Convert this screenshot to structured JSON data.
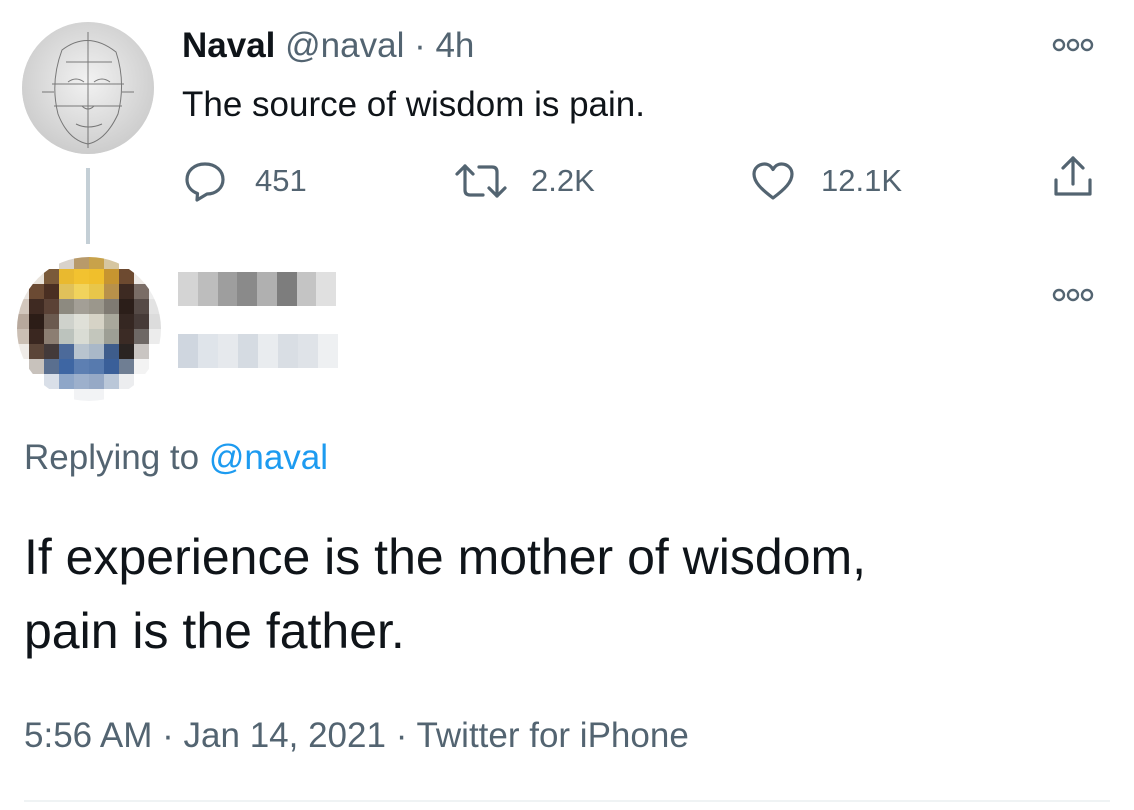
{
  "parent_tweet": {
    "display_name": "Naval",
    "handle": "@naval",
    "separator": "·",
    "time": "4h",
    "text": "The source of wisdom is pain.",
    "avatar_icon": "sketched-face-avatar",
    "actions": {
      "reply": {
        "icon": "comment-icon",
        "count": "451"
      },
      "retweet": {
        "icon": "retweet-icon",
        "count": "2.2K"
      },
      "like": {
        "icon": "heart-icon",
        "count": "12.1K"
      },
      "share": {
        "icon": "share-icon"
      }
    },
    "more_icon": "more-options-icon"
  },
  "reply_tweet": {
    "avatar_icon": "pixelated-avatar",
    "display_name_obscured": true,
    "handle_obscured": true,
    "replying_prefix": "Replying to",
    "replying_mention": "@naval",
    "text_line1": "If experience is the mother of wisdom,",
    "text_line2": "pain is the father.",
    "time": "5:56 AM",
    "date": "Jan 14, 2021",
    "source": "Twitter for iPhone",
    "separator": "·",
    "more_icon": "more-options-icon"
  },
  "colors": {
    "text_primary": "#0f1419",
    "text_secondary": "#536471",
    "link_blue": "#1d9bf0",
    "thread_line": "#c4cfd6",
    "divider": "#eff3f4"
  }
}
